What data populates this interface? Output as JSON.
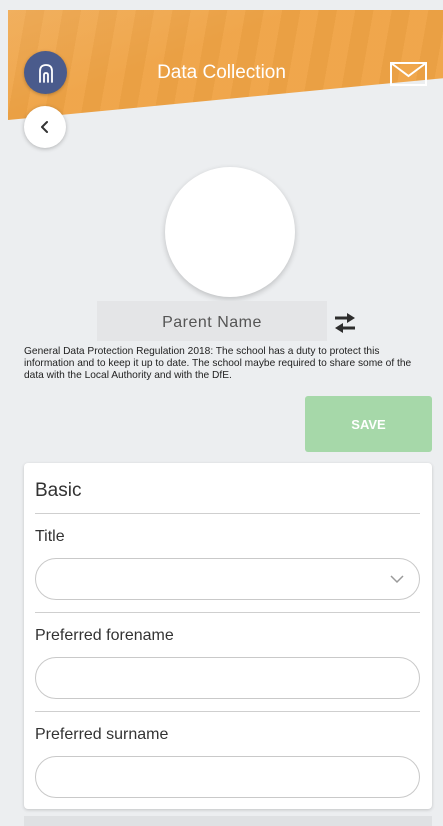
{
  "header": {
    "title": "Data Collection",
    "accent_color": "#efa345",
    "home_icon": "home-icon",
    "mail_icon": "mail-icon",
    "back_icon": "chevron-left-icon"
  },
  "profile": {
    "name": "Parent Name",
    "swap_icon": "swap-arrows-icon"
  },
  "gdpr_notice": "General Data Protection Regulation 2018: The school has a duty to protect this information and to keep it up to date. The school maybe required to share some of the data with the Local Authority and with the DfE.",
  "save_label": "SAVE",
  "save_color": "#a6d8a9",
  "form": {
    "section_title": "Basic",
    "fields": [
      {
        "label": "Title",
        "type": "select",
        "value": ""
      },
      {
        "label": "Preferred forename",
        "type": "text",
        "value": ""
      },
      {
        "label": "Preferred surname",
        "type": "text",
        "value": ""
      }
    ]
  }
}
